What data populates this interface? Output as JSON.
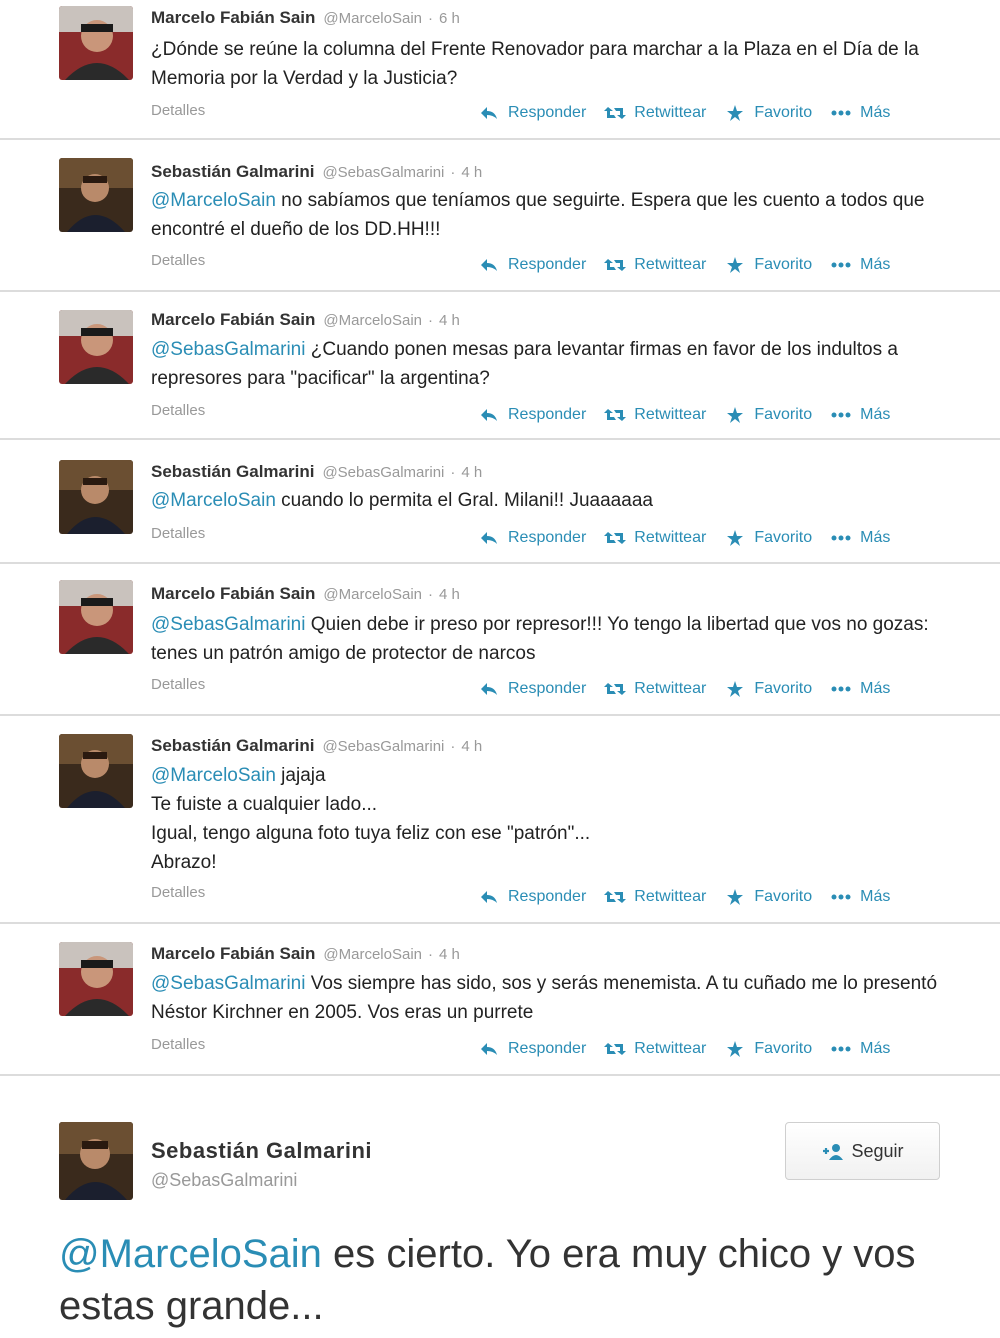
{
  "labels": {
    "details": "Detalles",
    "reply": "Responder",
    "retweet": "Retwittear",
    "favorite": "Favorito",
    "more": "Más"
  },
  "tweets": [
    {
      "name": "Marcelo Fabián Sain",
      "handle": "@MarceloSain",
      "time": "6 h",
      "mention": "",
      "text": "¿Dónde se reúne la columna del Frente Renovador para marchar a la Plaza en el Día de la Memoria por la Verdad y la Justicia?"
    },
    {
      "name": "Sebastián Galmarini",
      "handle": "@SebasGalmarini",
      "time": "4 h",
      "mention": "@MarceloSain",
      "text": " no sabíamos que teníamos que seguirte. Espera que les cuento a todos que encontré el dueño de los DD.HH!!!"
    },
    {
      "name": "Marcelo Fabián Sain",
      "handle": "@MarceloSain",
      "time": "4 h",
      "mention": "@SebasGalmarini",
      "text": " ¿Cuando ponen mesas para levantar firmas en favor de los indultos a represores para \"pacificar\" la argentina?"
    },
    {
      "name": "Sebastián Galmarini",
      "handle": "@SebasGalmarini",
      "time": "4 h",
      "mention": "@MarceloSain",
      "text": " cuando lo permita el Gral. Milani!! Juaaaaaa"
    },
    {
      "name": "Marcelo Fabián Sain",
      "handle": "@MarceloSain",
      "time": "4 h",
      "mention": "@SebasGalmarini",
      "text": " Quien debe ir preso por represor!!! Yo tengo la libertad que vos no gozas: tenes un patrón amigo de protector de narcos"
    },
    {
      "name": "Sebastián Galmarini",
      "handle": "@SebasGalmarini",
      "time": "4 h",
      "mention": "@MarceloSain",
      "text": " jajaja\nTe fuiste a cualquier lado...\nIgual, tengo alguna foto tuya feliz con ese \"patrón\"...\nAbrazo!"
    },
    {
      "name": "Marcelo Fabián Sain",
      "handle": "@MarceloSain",
      "time": "4 h",
      "mention": "@SebasGalmarini",
      "text": " Vos siempre has sido, sos y serás menemista. A tu cuñado me lo presentó Néstor Kirchner en 2005. Vos eras un purrete"
    }
  ],
  "featured": {
    "name": "Sebastián Galmarini",
    "handle": "@SebasGalmarini",
    "follow_label": "Seguir",
    "mention": "@MarceloSain",
    "text": " es cierto. Yo era muy chico y vos estas grande..."
  }
}
